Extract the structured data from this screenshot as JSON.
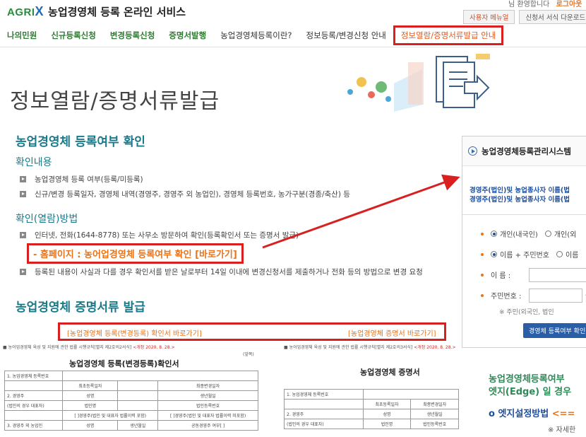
{
  "header": {
    "logo_text": "AGRIX",
    "logo_x": "X",
    "logo_agri": "AGRI",
    "service_title": "농업경영체 등록 온라인 서비스",
    "welcome": "님 환영합니다",
    "logout": "로그아웃",
    "user_menu": "사용자 메뉴얼",
    "form_download": "신청서 서식 다운로드"
  },
  "gnb": {
    "items": [
      {
        "label": "나의민원"
      },
      {
        "label": "신규등록신청"
      },
      {
        "label": "변경등록신청"
      },
      {
        "label": "증명서발행"
      },
      {
        "label": "농업경영체등록이란?"
      },
      {
        "label": "정보등록/변경신청 안내"
      },
      {
        "label": "정보열람/증명서류발급 안내"
      }
    ]
  },
  "banner": {
    "title": "정보열람/증명서류발급"
  },
  "section1": {
    "title": "농업경영체 등록여부 확인",
    "content_heading": "확인내용",
    "content_items": [
      "농업경영체 등록 여부(등록/미등록)",
      "신규/변경 등록일자, 경영체 내역(경영주, 경영주 외 농업인), 경영체 등록번호, 농가구분(경종/축산) 등"
    ],
    "method_heading": "확인(열람)방법",
    "method_item": "인터넷, 전화(1644-8778) 또는 사무소 방문하여 확인(등록확인서 또는 증명서 발급)",
    "homepage_link": "- 홈페이지 : 농어업경영체 등록여부 확인 [바로가기]",
    "change_item": "등록된 내용이 사실과 다를 경우 확인서를 받은 날로부터 14일 이내에 변경신청서를 제출하거나 전화 등의 방법으로 변경 요청"
  },
  "section2": {
    "title": "농업경영체 증명서류 발급",
    "link_confirm": "[농업경영체 등록(변경등록) 확인서 바로가기]",
    "link_cert": "[농업경영체 증명서 바로가기]"
  },
  "doc1": {
    "caption": "■ 농어업경영체 육성 및 지원에 관한 법률 시행규칙[별지 제2호의2서식]",
    "caption_red": "<개정 2020. 8. 28.>",
    "page_no": "(앞쪽)",
    "title": "농업경영체 등록(변경등록)확인서",
    "rows": [
      [
        "1. 농업경영체 등록번호",
        "",
        "",
        ""
      ],
      [
        "",
        "최초등록일자",
        "",
        "최종변경일자"
      ],
      [
        "2. 경영주",
        "성명",
        "",
        "생년월일"
      ],
      [
        "(법인의 경우 대표자)",
        "법인명",
        "",
        "법인등록번호"
      ],
      [
        "",
        "[ ]경영주(법인 및 대표자 법률이력 포함)",
        "",
        "[ ]경영주(법인 및 대표자 법률이력 미포함)"
      ],
      [
        "3. 경영주 외 농업인",
        "성명",
        "생년월일",
        "공동경영주 여부[ ]"
      ]
    ]
  },
  "doc2": {
    "caption": "■ 농어업경영체 육성 및 지원에 관한 법률 시행규칙[별지 제2호의3서식]",
    "caption_red": "<개정 2020. 8. 28.>",
    "title": "농업경영체 증명서",
    "rows": [
      [
        "1. 농업경영체 등록번호",
        "",
        ""
      ],
      [
        "",
        "최초등록일자",
        "최종변경일자"
      ],
      [
        "2. 경영주",
        "성명",
        "생년월일"
      ],
      [
        "(법인의 경우 대표자)",
        "법인명",
        "법인등록번호"
      ]
    ]
  },
  "rpanel": {
    "title": "농업경영체등록관리시스템",
    "notice_line1": "경영주(법인)및 농업종사자 이름(법",
    "notice_line2": "경영주(법인)및 농업종사자 이름(법",
    "type_person": "개인(내국인)",
    "type_other": "개인(외",
    "id_name": "이름 + 주민번호",
    "id_other": "이름",
    "name_label": "이    름 :",
    "rrn_label": "주민번호 :",
    "rrn_dash": "-",
    "note": "※ 주민(외국인, 법인",
    "check_button": "경영체 등록여부 확인",
    "edge_line1": "농업경영체등록여부",
    "edge_line2": "엣지(Edge) 일 경우",
    "edge_setting": "o 엣지설정방법",
    "edge_arrow": "<==",
    "detail": "※ 자세한"
  },
  "colors": {
    "accent_red": "#d82020",
    "brand_green": "#2e7d32",
    "heading_teal": "#1a7a8a",
    "link_orange": "#e8741c"
  }
}
